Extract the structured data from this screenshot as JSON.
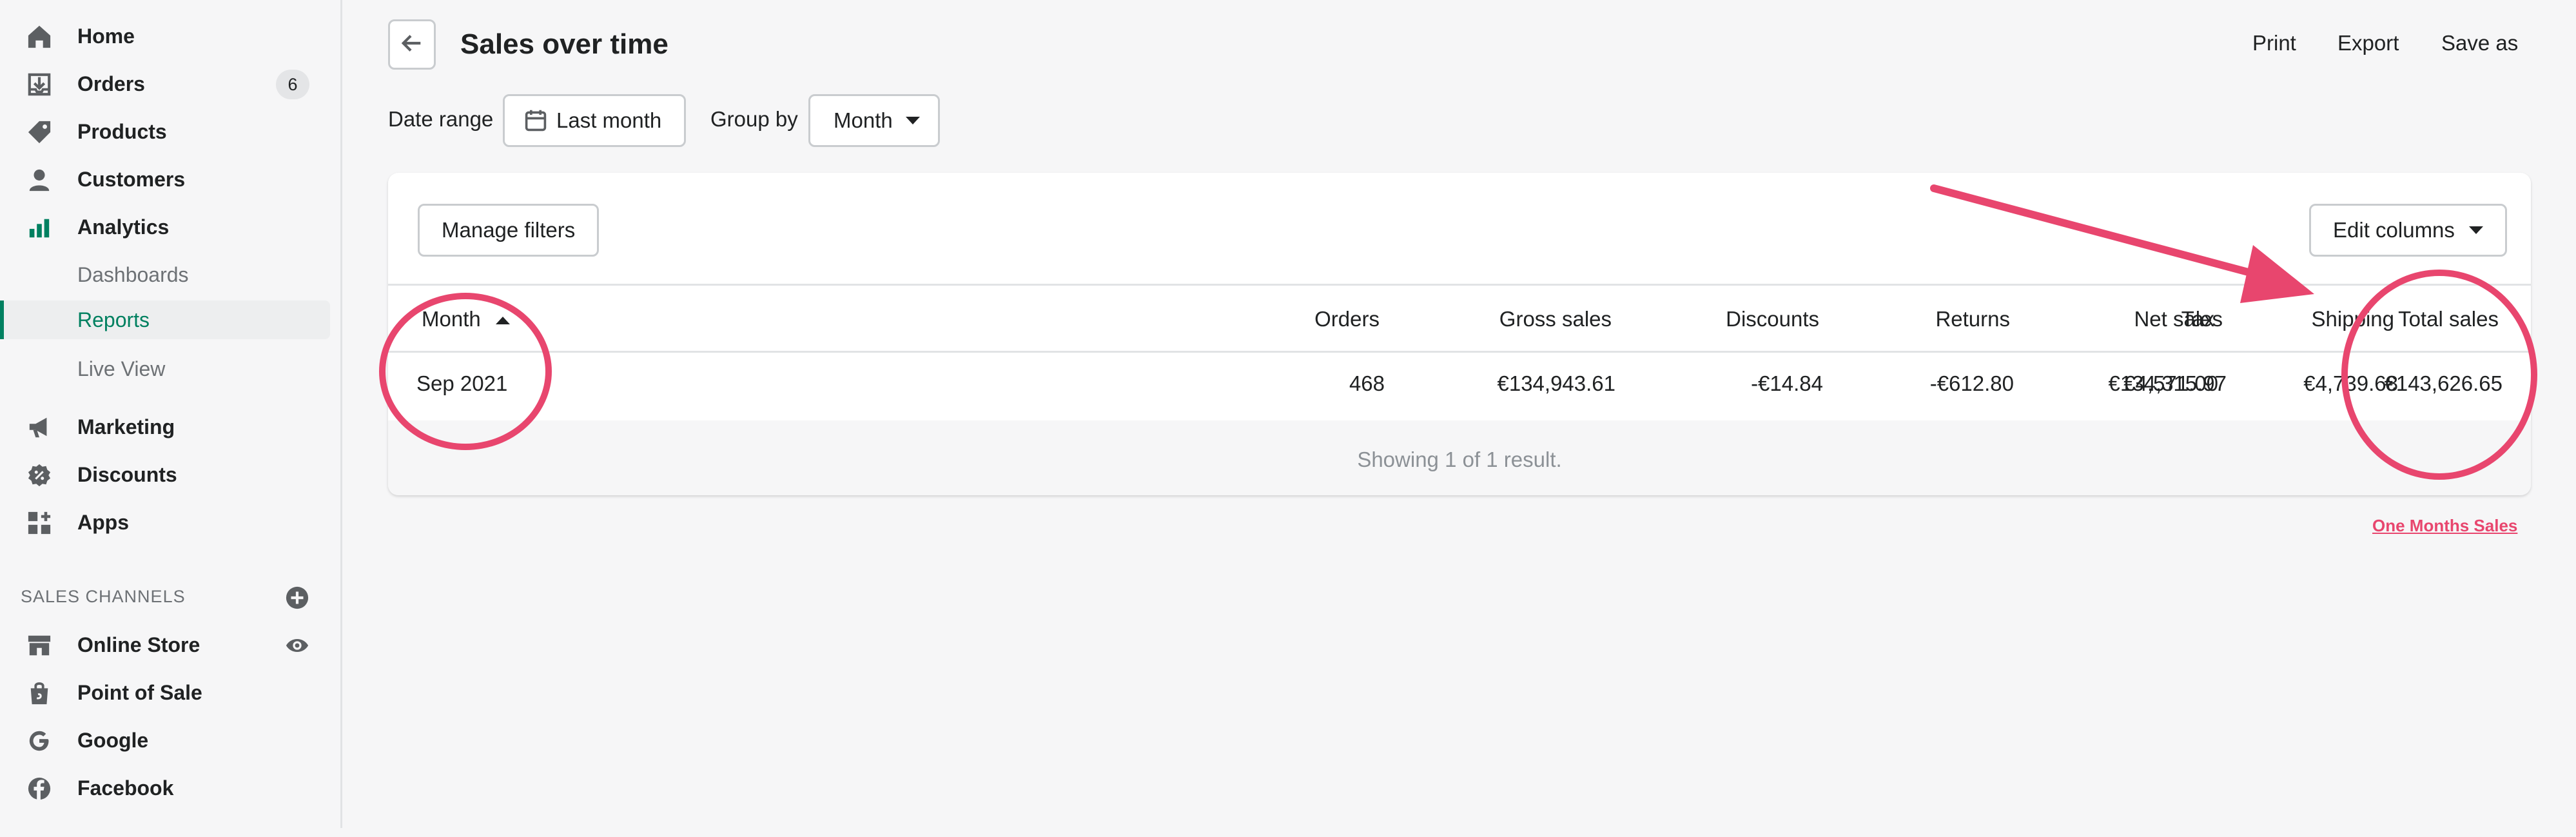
{
  "sidebar": {
    "items": [
      {
        "label": "Home",
        "icon": "home-icon"
      },
      {
        "label": "Orders",
        "icon": "orders-icon",
        "badge": "6"
      },
      {
        "label": "Products",
        "icon": "tag-icon"
      },
      {
        "label": "Customers",
        "icon": "person-icon"
      },
      {
        "label": "Analytics",
        "icon": "bar-chart-icon"
      }
    ],
    "analytics_sub": [
      "Dashboards",
      "Reports",
      "Live View"
    ],
    "items2": [
      {
        "label": "Marketing",
        "icon": "megaphone-icon"
      },
      {
        "label": "Discounts",
        "icon": "discount-icon"
      },
      {
        "label": "Apps",
        "icon": "apps-icon"
      }
    ],
    "sales_channels_title": "SALES CHANNELS",
    "channels": [
      {
        "label": "Online Store",
        "icon": "store-icon"
      },
      {
        "label": "Point of Sale",
        "icon": "shopping-bag-icon"
      },
      {
        "label": "Google",
        "icon": "google-icon"
      },
      {
        "label": "Facebook",
        "icon": "facebook-icon"
      }
    ]
  },
  "header": {
    "title": "Sales over time",
    "actions": {
      "print": "Print",
      "export": "Export",
      "save_as": "Save as"
    }
  },
  "filters": {
    "date_range_label": "Date range",
    "date_range_value": "Last month",
    "group_by_label": "Group by",
    "group_by_value": "Month"
  },
  "report": {
    "manage_filters": "Manage filters",
    "edit_columns": "Edit columns",
    "columns": {
      "month": "Month",
      "orders": "Orders",
      "gross_sales": "Gross sales",
      "discounts": "Discounts",
      "returns": "Returns",
      "net_sales": "Net sales",
      "shipping": "Shipping",
      "tax": "Tax",
      "total_sales": "Total sales"
    },
    "row": {
      "month": "Sep 2021",
      "orders": "468",
      "gross_sales": "€134,943.61",
      "discounts": "-€14.84",
      "returns": "-€612.80",
      "net_sales": "€134,315.97",
      "shipping": "€4,739.68",
      "tax": "€4,571.00",
      "total_sales": "€143,626.65"
    },
    "footer": "Showing 1 of 1 result."
  },
  "annotation": {
    "caption": "One Months Sales",
    "color": "#e8466e"
  },
  "colors": {
    "accent": "#008060",
    "annotation": "#e8466e"
  }
}
